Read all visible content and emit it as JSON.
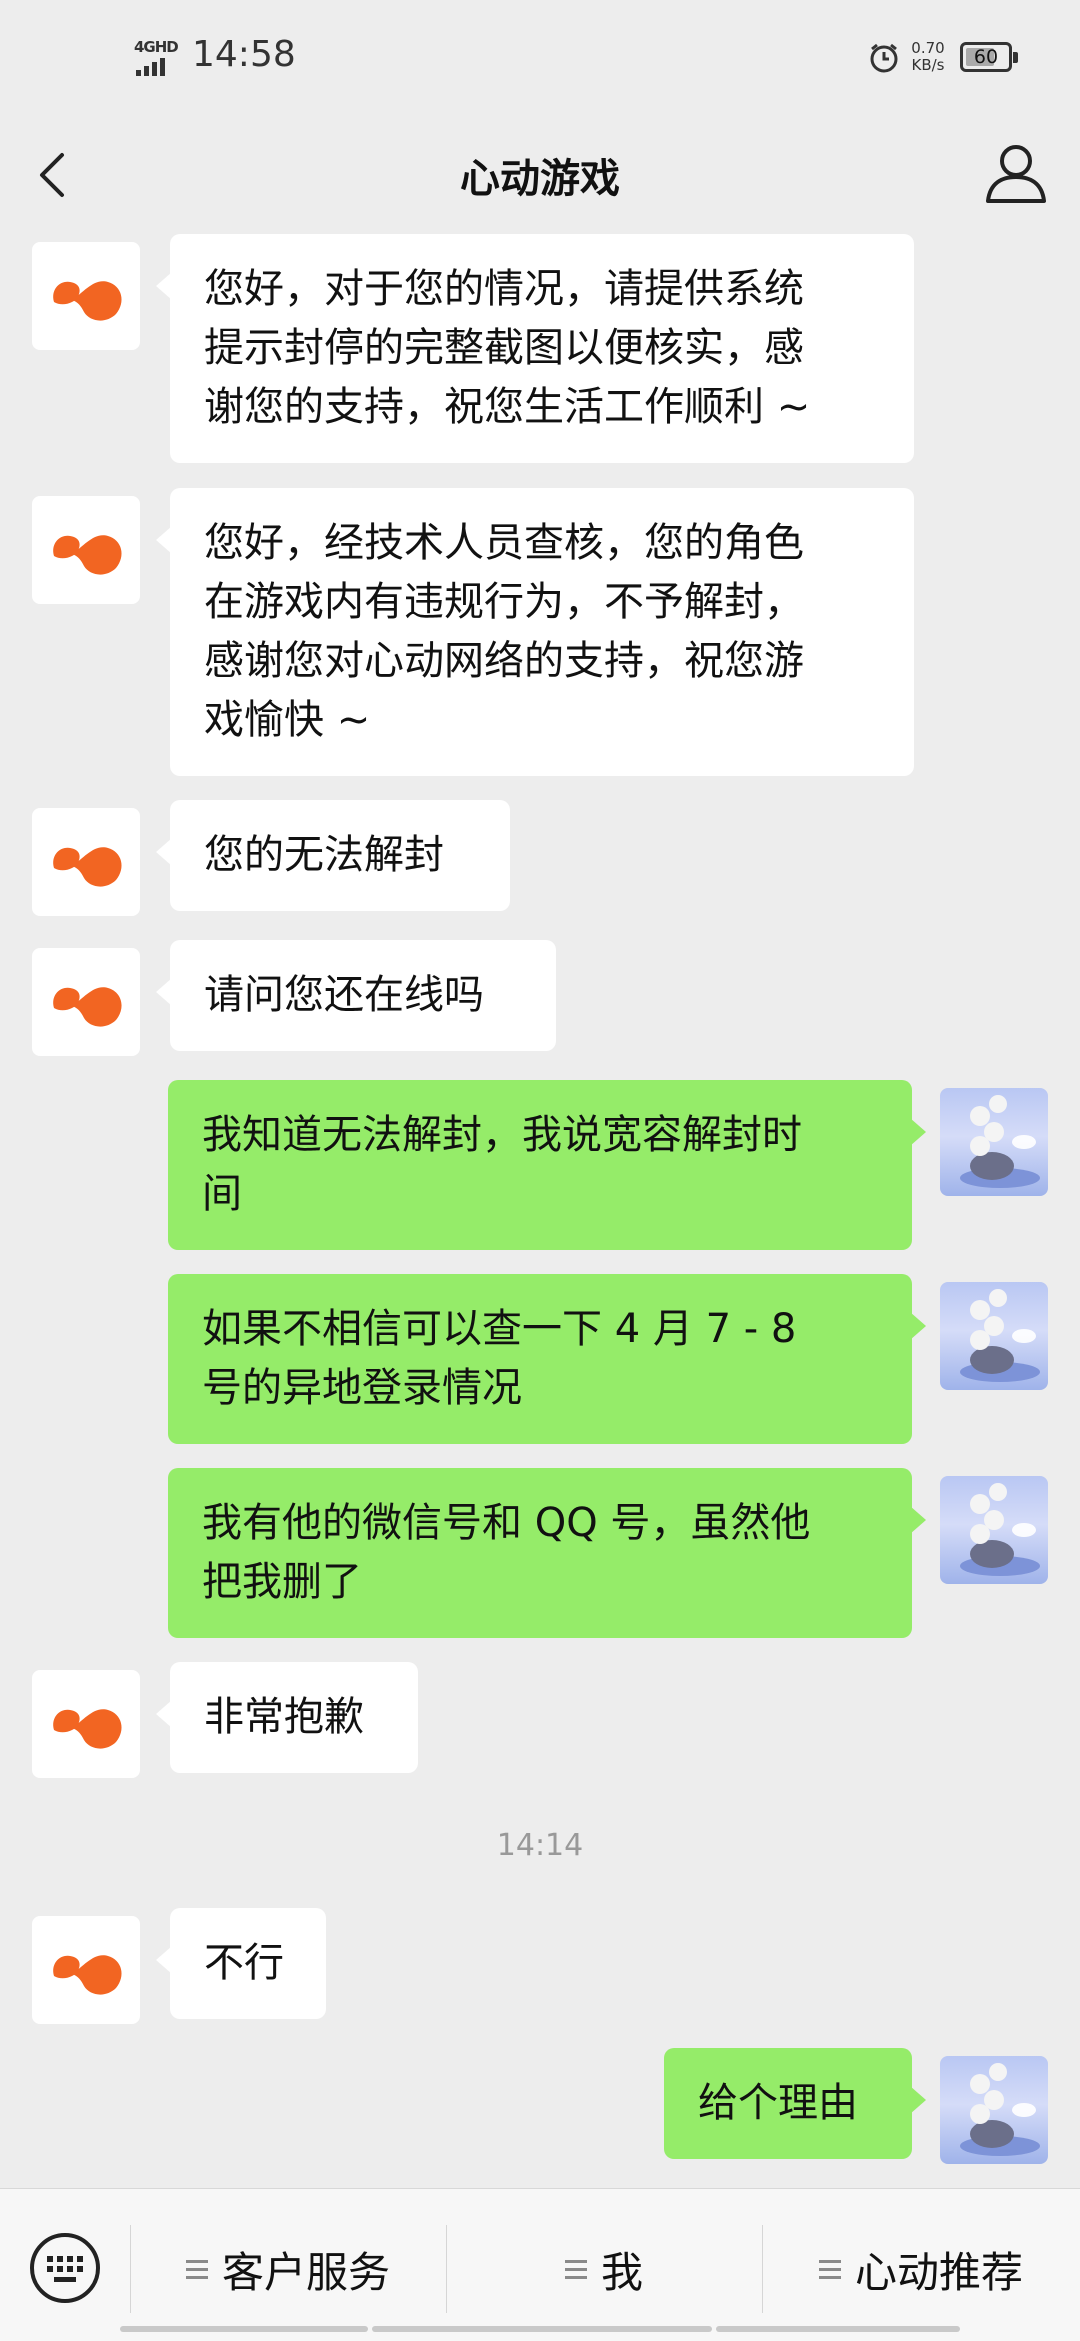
{
  "status_bar": {
    "network": "4GHD",
    "time": "14:58",
    "speed_value": "0.70",
    "speed_unit": "KB/s",
    "battery": "60"
  },
  "header": {
    "title": "心动游戏",
    "back_icon": "chevron-left-icon",
    "profile_icon": "person-icon"
  },
  "messages": [
    {
      "from": "bot",
      "lines": [
        "您好，对于您的情况，请提供系统",
        "提示封停的完整截图以便核实，感",
        "谢您的支持，祝您生活工作顺利 ~"
      ]
    },
    {
      "from": "bot",
      "lines": [
        "您好，经技术人员查核，您的角色",
        "在游戏内有违规行为，不予解封，",
        "感谢您对心动网络的支持，祝您游",
        "戏愉快 ~"
      ]
    },
    {
      "from": "bot",
      "lines": [
        "您的无法解封"
      ]
    },
    {
      "from": "bot",
      "lines": [
        "请问您还在线吗"
      ]
    },
    {
      "from": "me",
      "lines": [
        "我知道无法解封，我说宽容解封时",
        "间"
      ]
    },
    {
      "from": "me",
      "lines": [
        "如果不相信可以查一下 4 月 7 - 8",
        "号的异地登录情况"
      ]
    },
    {
      "from": "me",
      "lines": [
        "我有他的微信号和 QQ 号，虽然他",
        "把我删了"
      ]
    },
    {
      "from": "bot",
      "lines": [
        "非常抱歉"
      ]
    },
    {
      "from": "bot",
      "lines": [
        "不行"
      ]
    },
    {
      "from": "me",
      "lines": [
        "给个理由"
      ]
    }
  ],
  "timestamp": "14:14",
  "bottom_menu": {
    "keyboard_icon": "keyboard-icon",
    "items": [
      "客户服务",
      "我",
      "心动推荐"
    ]
  },
  "colors": {
    "background": "#ededed",
    "my_bubble": "#95ec69",
    "bot_bubble": "#ffffff",
    "brand_logo": "#f26522"
  }
}
